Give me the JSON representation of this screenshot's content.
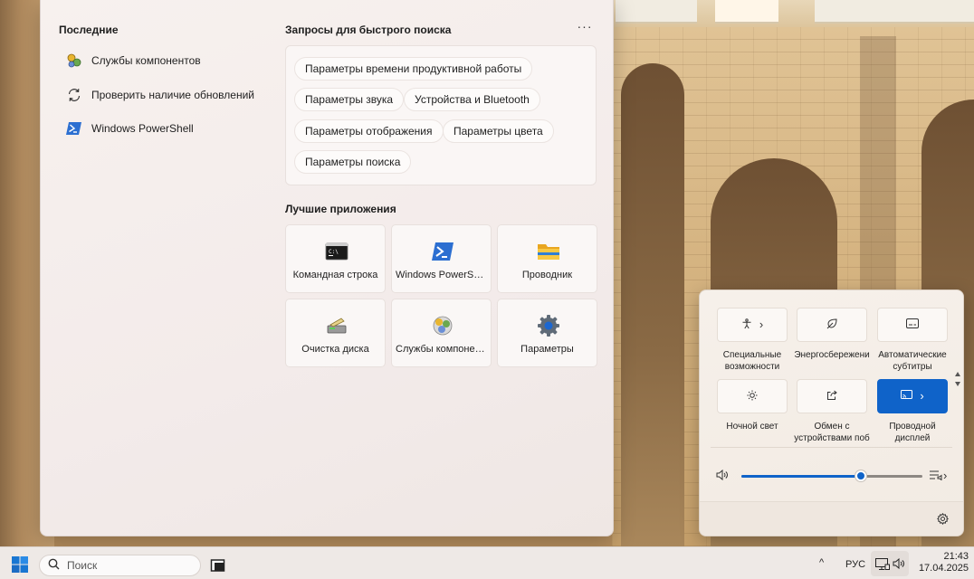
{
  "start_menu": {
    "recent": {
      "title": "Последние",
      "items": [
        {
          "label": "Службы компонентов",
          "icon": "component-services-icon"
        },
        {
          "label": "Проверить наличие обновлений",
          "icon": "refresh-icon"
        },
        {
          "label": "Windows PowerShell",
          "icon": "powershell-icon"
        }
      ]
    },
    "quick_search": {
      "title": "Запросы для быстрого поиска",
      "more_label": "···",
      "chips": [
        "Параметры времени продуктивной работы",
        "Параметры звука",
        "Устройства и Bluetooth",
        "Параметры отображения",
        "Параметры цвета",
        "Параметры поиска"
      ]
    },
    "top_apps": {
      "title": "Лучшие приложения",
      "apps": [
        {
          "label": "Командная строка",
          "icon": "command-prompt-icon"
        },
        {
          "label": "Windows PowerShell",
          "icon": "powershell-icon"
        },
        {
          "label": "Проводник",
          "icon": "file-explorer-icon"
        },
        {
          "label": "Очистка диска",
          "icon": "disk-cleanup-icon"
        },
        {
          "label": "Службы компонен...",
          "icon": "component-services-icon"
        },
        {
          "label": "Параметры",
          "icon": "settings-gear-icon"
        }
      ]
    }
  },
  "quick_settings": {
    "tiles": [
      {
        "label": "Специальные возможности",
        "icon": "accessibility-icon",
        "chevron": "›",
        "active": false
      },
      {
        "label": "Энергосбережени",
        "icon": "energy-saver-icon",
        "active": false
      },
      {
        "label": "Автоматические субтитры",
        "icon": "live-captions-icon",
        "active": false
      },
      {
        "label": "Ночной свет",
        "icon": "night-light-icon",
        "active": false
      },
      {
        "label": "Обмен с устройствами поб",
        "icon": "nearby-sharing-icon",
        "active": false
      },
      {
        "label": "Проводной дисплей",
        "icon": "cast-icon",
        "chevron": "›",
        "active": true
      }
    ],
    "volume": {
      "level": 0.66,
      "icon": "speaker-icon",
      "output_icon": "audio-output-icon",
      "chevron": "›"
    },
    "settings_icon": "settings-gear-icon"
  },
  "taskbar": {
    "start_icon": "windows-logo-icon",
    "search_placeholder": "Поиск",
    "search_icon": "search-icon",
    "tray": {
      "overflow_chevron": "^",
      "language": "РУС",
      "time": "21:43",
      "date": "17.04.2025"
    }
  },
  "colors": {
    "accent": "#0f63c9",
    "menu_background": "#f3ebea",
    "taskbar_background": "#eee9e6"
  }
}
